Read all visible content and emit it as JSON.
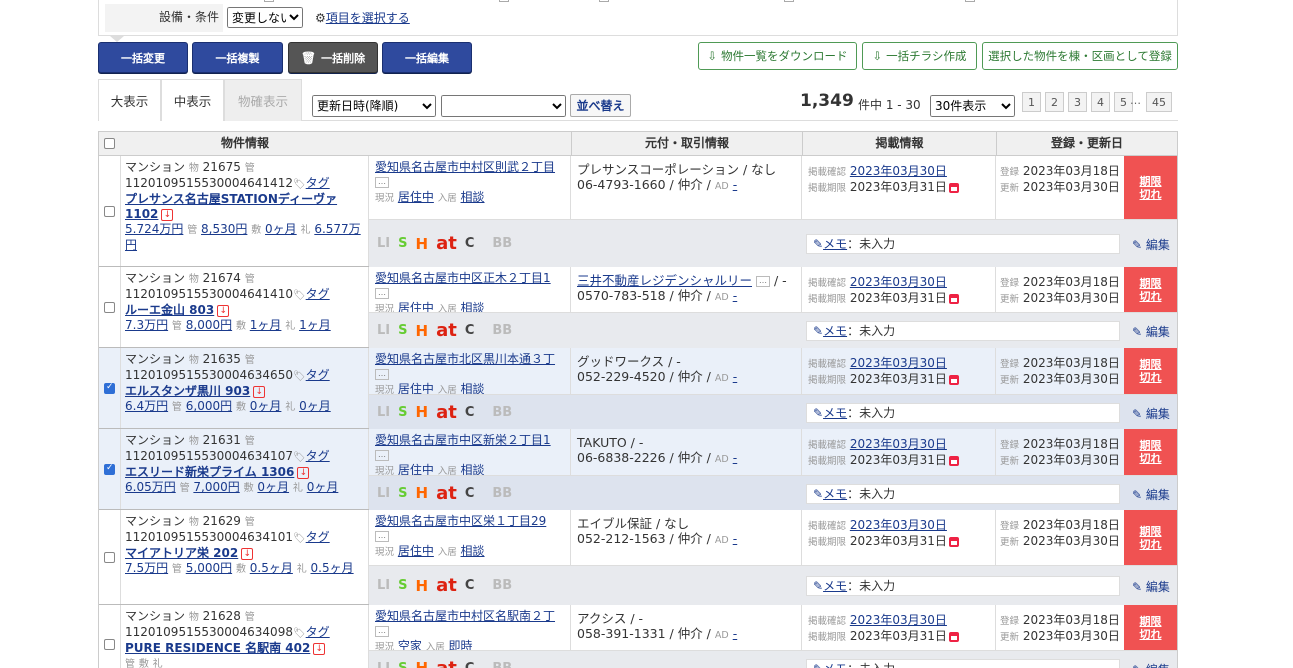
{
  "filter": {
    "label": "設備・条件",
    "select_value": "変更しない",
    "select_items_link": "項目を選択する"
  },
  "bulk_buttons": [
    "一括変更",
    "一括複製",
    "一括削除",
    "一括編集"
  ],
  "action_buttons": [
    "物件一覧をダウンロード",
    "一括チラシ作成",
    "選択した物件を棟・区画として登録"
  ],
  "view_tabs": [
    "大表示",
    "中表示",
    "物確表示"
  ],
  "sort": {
    "select_value": "更新日時(降順)",
    "select2_value": "",
    "button": "並べ替え"
  },
  "count": {
    "total": "1,349",
    "suffix": "件中 1 - 30"
  },
  "per_page": "30件表示",
  "pages": [
    "1",
    "2",
    "3",
    "4",
    "5",
    "45"
  ],
  "page_dots": "…",
  "headers": [
    "物件情報",
    "元付・取引情報",
    "掲載情報",
    "登録・更新日"
  ],
  "labels": {
    "type_prefix": "物",
    "mgmt_prefix": "管",
    "tag": "タグ",
    "status_prefix": "現況",
    "move_prefix": "入居",
    "published_confirm": "掲載確認",
    "published_limit": "掲載期限",
    "registered": "登録",
    "updated": "更新",
    "ad": "AD",
    "ad_value": "-",
    "expired": "期限\n切れ",
    "memo_link": "メモ",
    "memo_value": "：未入力",
    "edit": "編集",
    "deposit_prefix": "敷",
    "key_prefix": "礼",
    "portals": [
      "LI",
      "S",
      "H",
      "at",
      "C",
      "BB"
    ]
  },
  "rows": [
    {
      "checked": false,
      "type": "マンション",
      "num": "21675",
      "code": "1120109515530004641412",
      "name": "プレサンス名古屋STATIONディーヴァ 1102",
      "rent": "5.724万円",
      "mgmt": "8,530円",
      "deposit": "0ヶ月",
      "key": "6.577万円",
      "address": "愛知県名古屋市中村区則武２丁目",
      "status": "居住中",
      "move": "相談",
      "company": "プレサンスコーポレーション / なし",
      "phone": "06-4793-1660 / 仲介 /",
      "confirm": "2023年03月30日",
      "limit": "2023年03月31日",
      "reg": "2023年03月18日",
      "upd": "2023年03月30日"
    },
    {
      "checked": false,
      "type": "マンション",
      "num": "21674",
      "code": "1120109515530004641410",
      "name": "ルーエ金山 803",
      "rent": "7.3万円",
      "mgmt": "8,000円",
      "deposit": "1ヶ月",
      "key": "1ヶ月",
      "address": "愛知県名古屋市中区正木２丁目1",
      "status": "居住中",
      "move": "相談",
      "company": "三井不動産レジデンシャルリー",
      "company_suffix": "/ -",
      "phone": "0570-783-518 / 仲介 /",
      "confirm": "2023年03月30日",
      "limit": "2023年03月31日",
      "reg": "2023年03月18日",
      "upd": "2023年03月30日"
    },
    {
      "checked": true,
      "type": "マンション",
      "num": "21635",
      "code": "1120109515530004634650",
      "name": "エルスタンザ黒川 903",
      "rent": "6.4万円",
      "mgmt": "6,000円",
      "deposit": "0ヶ月",
      "key": "0ヶ月",
      "address": "愛知県名古屋市北区黒川本通３丁",
      "status": "居住中",
      "move": "相談",
      "company": "グッドワークス / -",
      "phone": "052-229-4520 / 仲介 /",
      "confirm": "2023年03月30日",
      "limit": "2023年03月31日",
      "reg": "2023年03月18日",
      "upd": "2023年03月30日"
    },
    {
      "checked": true,
      "type": "マンション",
      "num": "21631",
      "code": "1120109515530004634107",
      "name": "エスリード新栄プライム 1306",
      "rent": "6.05万円",
      "mgmt": "7,000円",
      "deposit": "0ヶ月",
      "key": "0ヶ月",
      "address": "愛知県名古屋市中区新栄２丁目1",
      "status": "居住中",
      "move": "相談",
      "company": "TAKUTO / -",
      "phone": "06-6838-2226 / 仲介 /",
      "confirm": "2023年03月30日",
      "limit": "2023年03月31日",
      "reg": "2023年03月18日",
      "upd": "2023年03月30日"
    },
    {
      "checked": false,
      "type": "マンション",
      "num": "21629",
      "code": "1120109515530004634101",
      "name": "マイアトリア栄 202",
      "rent": "7.5万円",
      "mgmt": "5,000円",
      "deposit": "0.5ヶ月",
      "key": "0.5ヶ月",
      "address": "愛知県名古屋市中区栄１丁目29",
      "status": "居住中",
      "move": "相談",
      "company": "エイブル保証 / なし",
      "phone": "052-212-1563 / 仲介 /",
      "confirm": "2023年03月30日",
      "limit": "2023年03月31日",
      "reg": "2023年03月18日",
      "upd": "2023年03月30日"
    },
    {
      "checked": false,
      "type": "マンション",
      "num": "21628",
      "code": "1120109515530004634098",
      "name": "PURE RESIDENCE 名駅南 402",
      "rent": "",
      "mgmt": "",
      "deposit": "",
      "key": "",
      "address": "愛知県名古屋市中村区名駅南２丁",
      "status": "空家",
      "move": "即時",
      "company": "アクシス / -",
      "phone": "058-391-1331 / 仲介 /",
      "confirm": "2023年03月30日",
      "limit": "2023年03月31日",
      "reg": "2023年03月18日",
      "upd": "2023年03月30日"
    }
  ]
}
